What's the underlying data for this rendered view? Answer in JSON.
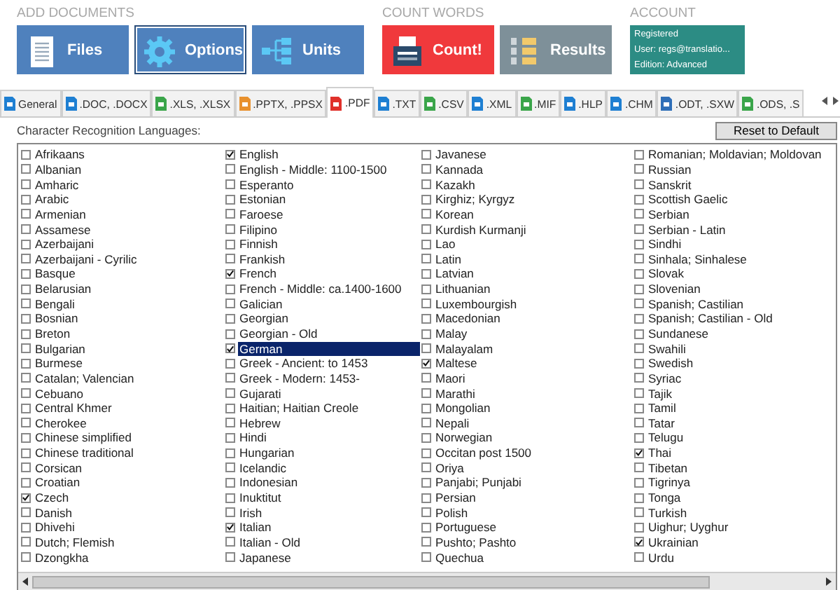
{
  "sections": [
    {
      "title": "ADD DOCUMENTS",
      "buttons": [
        {
          "label": "Files",
          "selected": false,
          "color": "#4f81bd"
        },
        {
          "label": "Options",
          "selected": true,
          "color": "#4f81bd"
        },
        {
          "label": "Units",
          "selected": false,
          "color": "#4f81bd"
        }
      ]
    },
    {
      "title": "COUNT WORDS",
      "buttons": [
        {
          "label": "Count!",
          "selected": false,
          "color": "#f0393c"
        },
        {
          "label": "Results",
          "selected": false,
          "color": "#7e9099"
        }
      ]
    },
    {
      "title": "ACCOUNT",
      "account": [
        "Registered",
        "User: regs@translatio...",
        "Edition: Advanced"
      ]
    }
  ],
  "tabs": [
    {
      "label": "General",
      "selected": false,
      "color": "#1e7fd2"
    },
    {
      "label": ".DOC, .DOCX",
      "selected": false,
      "color": "#1e7fd2"
    },
    {
      "label": ".XLS, .XLSX",
      "selected": false,
      "color": "#3aa54a"
    },
    {
      "label": ".PPTX, .PPSX",
      "selected": false,
      "color": "#e8912e"
    },
    {
      "label": ".PDF",
      "selected": true,
      "color": "#e0312b"
    },
    {
      "label": ".TXT",
      "selected": false,
      "color": "#1e7fd2"
    },
    {
      "label": ".CSV",
      "selected": false,
      "color": "#3aa54a"
    },
    {
      "label": ".XML",
      "selected": false,
      "color": "#1e7fd2"
    },
    {
      "label": ".MIF",
      "selected": false,
      "color": "#3aa54a"
    },
    {
      "label": ".HLP",
      "selected": false,
      "color": "#1e7fd2"
    },
    {
      "label": ".CHM",
      "selected": false,
      "color": "#1e7fd2"
    },
    {
      "label": ".ODT, .SXW",
      "selected": false,
      "color": "#2f6fb8"
    },
    {
      "label": ".ODS, .S",
      "selected": false,
      "color": "#3aa54a"
    }
  ],
  "panel": {
    "heading": "Character Recognition Languages:",
    "reset_button": "Reset to Default",
    "columns": [
      [
        {
          "label": "Afrikaans",
          "checked": false,
          "selected": false
        },
        {
          "label": "Albanian",
          "checked": false,
          "selected": false
        },
        {
          "label": "Amharic",
          "checked": false,
          "selected": false
        },
        {
          "label": "Arabic",
          "checked": false,
          "selected": false
        },
        {
          "label": "Armenian",
          "checked": false,
          "selected": false
        },
        {
          "label": "Assamese",
          "checked": false,
          "selected": false
        },
        {
          "label": "Azerbaijani",
          "checked": false,
          "selected": false
        },
        {
          "label": "Azerbaijani - Cyrilic",
          "checked": false,
          "selected": false
        },
        {
          "label": "Basque",
          "checked": false,
          "selected": false
        },
        {
          "label": "Belarusian",
          "checked": false,
          "selected": false
        },
        {
          "label": "Bengali",
          "checked": false,
          "selected": false
        },
        {
          "label": "Bosnian",
          "checked": false,
          "selected": false
        },
        {
          "label": "Breton",
          "checked": false,
          "selected": false
        },
        {
          "label": "Bulgarian",
          "checked": false,
          "selected": false
        },
        {
          "label": "Burmese",
          "checked": false,
          "selected": false
        },
        {
          "label": "Catalan; Valencian",
          "checked": false,
          "selected": false
        },
        {
          "label": "Cebuano",
          "checked": false,
          "selected": false
        },
        {
          "label": "Central Khmer",
          "checked": false,
          "selected": false
        },
        {
          "label": "Cherokee",
          "checked": false,
          "selected": false
        },
        {
          "label": "Chinese simplified",
          "checked": false,
          "selected": false
        },
        {
          "label": "Chinese traditional",
          "checked": false,
          "selected": false
        },
        {
          "label": "Corsican",
          "checked": false,
          "selected": false
        },
        {
          "label": "Croatian",
          "checked": false,
          "selected": false
        },
        {
          "label": "Czech",
          "checked": true,
          "selected": false
        },
        {
          "label": "Danish",
          "checked": false,
          "selected": false
        },
        {
          "label": "Dhivehi",
          "checked": false,
          "selected": false
        },
        {
          "label": "Dutch; Flemish",
          "checked": false,
          "selected": false
        },
        {
          "label": "Dzongkha",
          "checked": false,
          "selected": false
        }
      ],
      [
        {
          "label": "English",
          "checked": true,
          "selected": false
        },
        {
          "label": "English - Middle: 1100-1500",
          "checked": false,
          "selected": false
        },
        {
          "label": "Esperanto",
          "checked": false,
          "selected": false
        },
        {
          "label": "Estonian",
          "checked": false,
          "selected": false
        },
        {
          "label": "Faroese",
          "checked": false,
          "selected": false
        },
        {
          "label": "Filipino",
          "checked": false,
          "selected": false
        },
        {
          "label": "Finnish",
          "checked": false,
          "selected": false
        },
        {
          "label": "Frankish",
          "checked": false,
          "selected": false
        },
        {
          "label": "French",
          "checked": true,
          "selected": false
        },
        {
          "label": "French - Middle: ca.1400-1600",
          "checked": false,
          "selected": false
        },
        {
          "label": "Galician",
          "checked": false,
          "selected": false
        },
        {
          "label": "Georgian",
          "checked": false,
          "selected": false
        },
        {
          "label": "Georgian - Old",
          "checked": false,
          "selected": false
        },
        {
          "label": "German",
          "checked": true,
          "selected": true
        },
        {
          "label": "Greek - Ancient: to 1453",
          "checked": false,
          "selected": false
        },
        {
          "label": "Greek - Modern: 1453-",
          "checked": false,
          "selected": false
        },
        {
          "label": "Gujarati",
          "checked": false,
          "selected": false
        },
        {
          "label": "Haitian; Haitian Creole",
          "checked": false,
          "selected": false
        },
        {
          "label": "Hebrew",
          "checked": false,
          "selected": false
        },
        {
          "label": "Hindi",
          "checked": false,
          "selected": false
        },
        {
          "label": "Hungarian",
          "checked": false,
          "selected": false
        },
        {
          "label": "Icelandic",
          "checked": false,
          "selected": false
        },
        {
          "label": "Indonesian",
          "checked": false,
          "selected": false
        },
        {
          "label": "Inuktitut",
          "checked": false,
          "selected": false
        },
        {
          "label": "Irish",
          "checked": false,
          "selected": false
        },
        {
          "label": "Italian",
          "checked": true,
          "selected": false
        },
        {
          "label": "Italian - Old",
          "checked": false,
          "selected": false
        },
        {
          "label": "Japanese",
          "checked": false,
          "selected": false
        }
      ],
      [
        {
          "label": "Javanese",
          "checked": false,
          "selected": false
        },
        {
          "label": "Kannada",
          "checked": false,
          "selected": false
        },
        {
          "label": "Kazakh",
          "checked": false,
          "selected": false
        },
        {
          "label": "Kirghiz; Kyrgyz",
          "checked": false,
          "selected": false
        },
        {
          "label": "Korean",
          "checked": false,
          "selected": false
        },
        {
          "label": "Kurdish Kurmanji",
          "checked": false,
          "selected": false
        },
        {
          "label": "Lao",
          "checked": false,
          "selected": false
        },
        {
          "label": "Latin",
          "checked": false,
          "selected": false
        },
        {
          "label": "Latvian",
          "checked": false,
          "selected": false
        },
        {
          "label": "Lithuanian",
          "checked": false,
          "selected": false
        },
        {
          "label": "Luxembourgish",
          "checked": false,
          "selected": false
        },
        {
          "label": "Macedonian",
          "checked": false,
          "selected": false
        },
        {
          "label": "Malay",
          "checked": false,
          "selected": false
        },
        {
          "label": "Malayalam",
          "checked": false,
          "selected": false
        },
        {
          "label": "Maltese",
          "checked": true,
          "selected": false
        },
        {
          "label": "Maori",
          "checked": false,
          "selected": false
        },
        {
          "label": "Marathi",
          "checked": false,
          "selected": false
        },
        {
          "label": "Mongolian",
          "checked": false,
          "selected": false
        },
        {
          "label": "Nepali",
          "checked": false,
          "selected": false
        },
        {
          "label": "Norwegian",
          "checked": false,
          "selected": false
        },
        {
          "label": "Occitan post 1500",
          "checked": false,
          "selected": false
        },
        {
          "label": "Oriya",
          "checked": false,
          "selected": false
        },
        {
          "label": "Panjabi; Punjabi",
          "checked": false,
          "selected": false
        },
        {
          "label": "Persian",
          "checked": false,
          "selected": false
        },
        {
          "label": "Polish",
          "checked": false,
          "selected": false
        },
        {
          "label": "Portuguese",
          "checked": false,
          "selected": false
        },
        {
          "label": "Pushto; Pashto",
          "checked": false,
          "selected": false
        },
        {
          "label": "Quechua",
          "checked": false,
          "selected": false
        }
      ],
      [
        {
          "label": "Romanian; Moldavian; Moldovan",
          "checked": false,
          "selected": false
        },
        {
          "label": "Russian",
          "checked": false,
          "selected": false
        },
        {
          "label": "Sanskrit",
          "checked": false,
          "selected": false
        },
        {
          "label": "Scottish Gaelic",
          "checked": false,
          "selected": false
        },
        {
          "label": "Serbian",
          "checked": false,
          "selected": false
        },
        {
          "label": "Serbian - Latin",
          "checked": false,
          "selected": false
        },
        {
          "label": "Sindhi",
          "checked": false,
          "selected": false
        },
        {
          "label": "Sinhala; Sinhalese",
          "checked": false,
          "selected": false
        },
        {
          "label": "Slovak",
          "checked": false,
          "selected": false
        },
        {
          "label": "Slovenian",
          "checked": false,
          "selected": false
        },
        {
          "label": "Spanish; Castilian",
          "checked": false,
          "selected": false
        },
        {
          "label": "Spanish; Castilian - Old",
          "checked": false,
          "selected": false
        },
        {
          "label": "Sundanese",
          "checked": false,
          "selected": false
        },
        {
          "label": "Swahili",
          "checked": false,
          "selected": false
        },
        {
          "label": "Swedish",
          "checked": false,
          "selected": false
        },
        {
          "label": "Syriac",
          "checked": false,
          "selected": false
        },
        {
          "label": "Tajik",
          "checked": false,
          "selected": false
        },
        {
          "label": "Tamil",
          "checked": false,
          "selected": false
        },
        {
          "label": "Tatar",
          "checked": false,
          "selected": false
        },
        {
          "label": "Telugu",
          "checked": false,
          "selected": false
        },
        {
          "label": "Thai",
          "checked": true,
          "selected": false
        },
        {
          "label": "Tibetan",
          "checked": false,
          "selected": false
        },
        {
          "label": "Tigrinya",
          "checked": false,
          "selected": false
        },
        {
          "label": "Tonga",
          "checked": false,
          "selected": false
        },
        {
          "label": "Turkish",
          "checked": false,
          "selected": false
        },
        {
          "label": "Uighur; Uyghur",
          "checked": false,
          "selected": false
        },
        {
          "label": "Ukrainian",
          "checked": true,
          "selected": false
        },
        {
          "label": "Urdu",
          "checked": false,
          "selected": false
        }
      ]
    ]
  }
}
